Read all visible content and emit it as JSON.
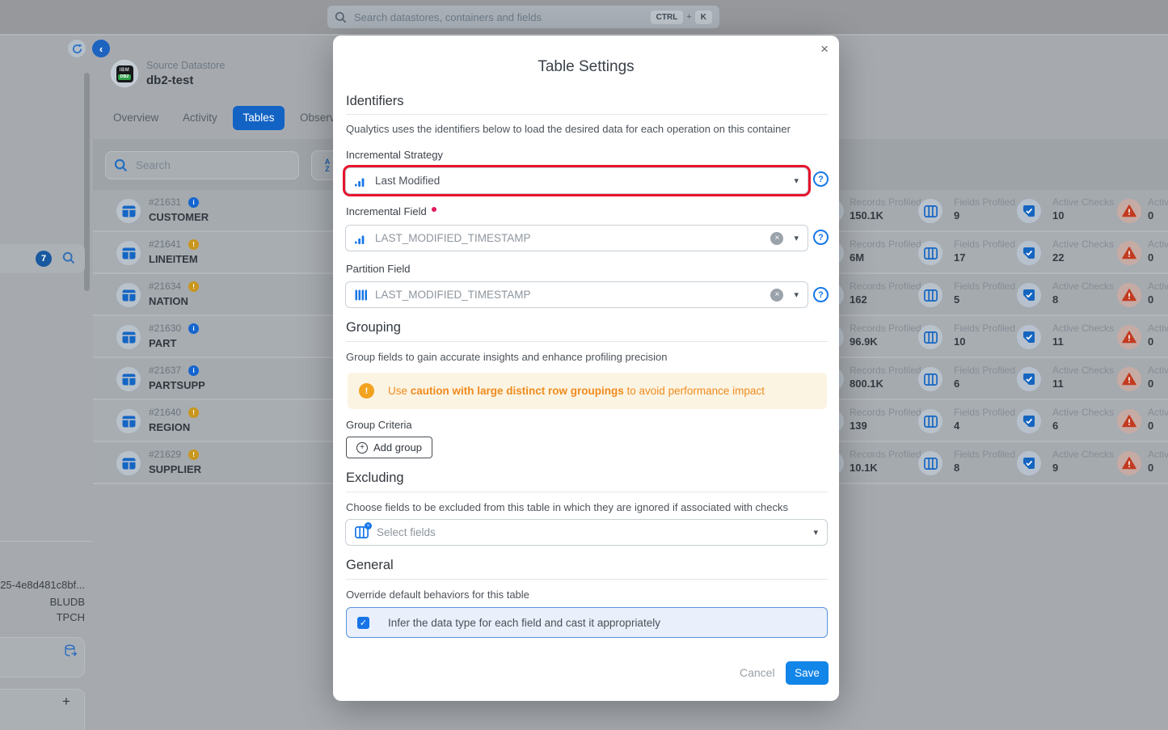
{
  "topbar": {
    "search_placeholder": "Search datastores, containers and fields",
    "shortcut": {
      "key1": "CTRL",
      "plus": "+",
      "key2": "K"
    }
  },
  "sidebar": {
    "badge_count": "7",
    "footer_lines": {
      "line1": "25-4e8d481c8bf...",
      "line2": "BLUDB",
      "line3": "TPCH"
    }
  },
  "header": {
    "type_label": "Source Datastore",
    "name": "db2-test",
    "logo": {
      "line1": "IBM",
      "line2": "DB2"
    },
    "tabs": [
      {
        "label": "Overview"
      },
      {
        "label": "Activity"
      },
      {
        "label": "Tables"
      },
      {
        "label": "Observ"
      }
    ]
  },
  "toolbar": {
    "search_placeholder": "Search"
  },
  "columns": {
    "records": "Records Profiled",
    "fields": "Fields Profiled",
    "checks": "Active Checks",
    "anomalies": "Activ"
  },
  "rows": [
    {
      "id": "#21631",
      "name": "CUSTOMER",
      "status": "info",
      "records": "150.1K",
      "fields": "9",
      "checks": "10",
      "anomalies": "0"
    },
    {
      "id": "#21641",
      "name": "LINEITEM",
      "status": "warn",
      "records": "6M",
      "fields": "17",
      "checks": "22",
      "anomalies": "0"
    },
    {
      "id": "#21634",
      "name": "NATION",
      "status": "warn",
      "records": "162",
      "fields": "5",
      "checks": "8",
      "anomalies": "0"
    },
    {
      "id": "#21630",
      "name": "PART",
      "status": "info",
      "records": "96.9K",
      "fields": "10",
      "checks": "11",
      "anomalies": "0"
    },
    {
      "id": "#21637",
      "name": "PARTSUPP",
      "status": "info",
      "records": "800.1K",
      "fields": "6",
      "checks": "11",
      "anomalies": "0"
    },
    {
      "id": "#21640",
      "name": "REGION",
      "status": "warn",
      "records": "139",
      "fields": "4",
      "checks": "6",
      "anomalies": "0"
    },
    {
      "id": "#21629",
      "name": "SUPPLIER",
      "status": "warn",
      "records": "10.1K",
      "fields": "8",
      "checks": "9",
      "anomalies": "0"
    }
  ],
  "modal": {
    "title": "Table Settings",
    "identifiers": {
      "heading": "Identifiers",
      "description": "Qualytics uses the identifiers below to load the desired data for each operation on this container",
      "incremental_strategy": {
        "label": "Incremental Strategy",
        "value": "Last Modified"
      },
      "incremental_field": {
        "label": "Incremental Field",
        "value": "LAST_MODIFIED_TIMESTAMP"
      },
      "partition_field": {
        "label": "Partition Field",
        "value": "LAST_MODIFIED_TIMESTAMP"
      }
    },
    "grouping": {
      "heading": "Grouping",
      "description": "Group fields to gain accurate insights and enhance profiling precision",
      "warning": {
        "prefix": "Use ",
        "bold": "caution with large distinct row groupings",
        "suffix": " to avoid performance impact"
      },
      "group_criteria_label": "Group Criteria",
      "add_group_label": "Add group"
    },
    "excluding": {
      "heading": "Excluding",
      "description": "Choose fields to be excluded from this table in which they are ignored if associated with checks",
      "placeholder": "Select fields"
    },
    "general": {
      "heading": "General",
      "description": "Override default behaviors for this table",
      "checkbox_label": "Infer the data type for each field and cast it appropriately",
      "checked": true
    },
    "footer": {
      "cancel_label": "Cancel",
      "save_label": "Save"
    }
  },
  "colors": {
    "highlight_red": "#e8142d",
    "primary_blue": "#1285e8",
    "warning_orange": "#ef8b1f",
    "tab_active_blue": "#1263c4"
  },
  "icons": {
    "close": "×",
    "caret": "▾",
    "check": "✓",
    "chevron_left": "‹",
    "plus": "+",
    "question": "?",
    "info": "i",
    "warning": "!",
    "sort_a": "A",
    "sort_z": "Z",
    "clear": "×"
  }
}
